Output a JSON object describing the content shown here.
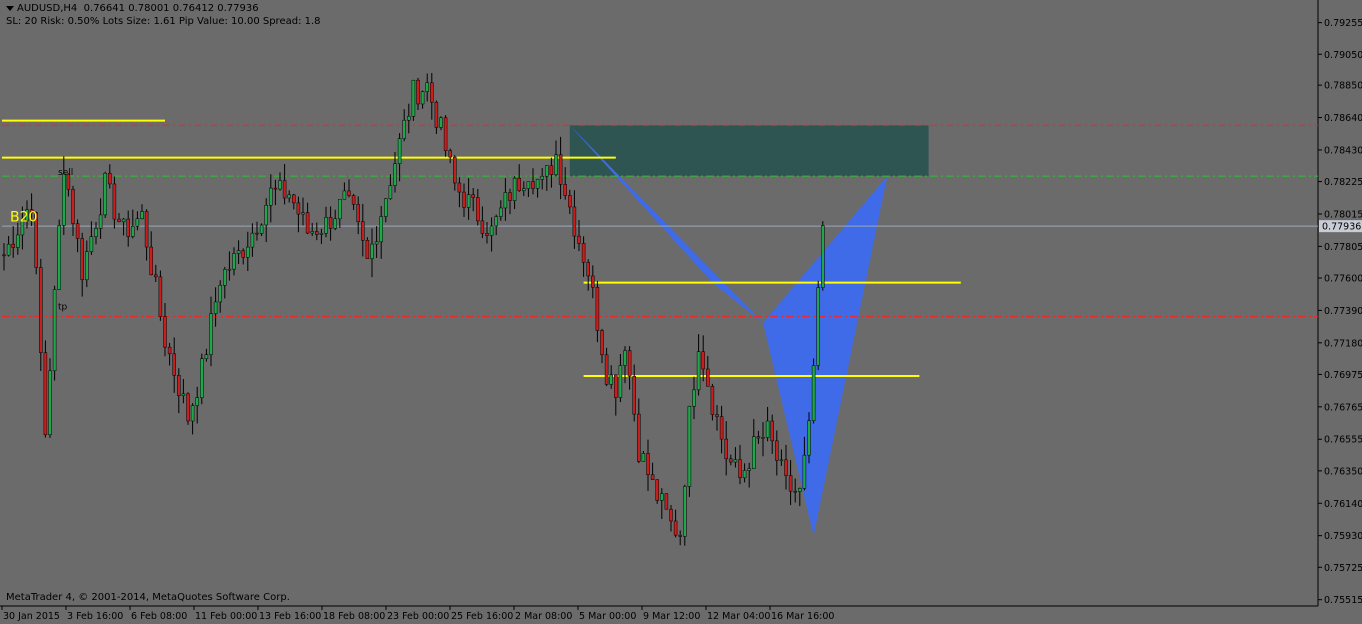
{
  "header": {
    "symbol": "AUDUSD,H4",
    "ohlc": "0.76641 0.78001 0.76412 0.77936",
    "risk_line": "SL: 20 Risk: 0.50%  Lots Size: 1.61 Pip Value: 10.00 Spread: 1.8"
  },
  "footer": {
    "copyright": "MetaTrader 4, © 2001-2014, MetaQuotes Software Corp."
  },
  "colors": {
    "background": "#6b6b6b",
    "bull": "#1fa84a",
    "bear": "#c81e1e",
    "wick": "#000000",
    "pattern": "#3d6cf0",
    "zone": "#2f5552",
    "level_yellow": "#ffff00",
    "level_red": "#ff2020",
    "level_green": "#30c030",
    "current_price_line": "#9aa7b8"
  },
  "chart_data": {
    "type": "candlestick",
    "timeframe": "H4",
    "ylim": [
      0.755,
      0.7935
    ],
    "y_ticks": [
      "0.79255",
      "0.79050",
      "0.78850",
      "0.78640",
      "0.78430",
      "0.78225",
      "0.78015",
      "0.77805",
      "0.77600",
      "0.77390",
      "0.77180",
      "0.76975",
      "0.76765",
      "0.76555",
      "0.76350",
      "0.76140",
      "0.75930",
      "0.75725",
      "0.75515"
    ],
    "x_labels": [
      "30 Jan 2015",
      "3 Feb 16:00",
      "6 Feb 08:00",
      "11 Feb 00:00",
      "13 Feb 16:00",
      "18 Feb 08:00",
      "23 Feb 00:00",
      "25 Feb 16:00",
      "2 Mar 08:00",
      "5 Mar 00:00",
      "9 Mar 12:00",
      "12 Mar 04:00",
      "16 Mar 16:00"
    ],
    "current_price": 0.77936,
    "current_price_label": "0.77936",
    "anchors": [
      [
        0,
        0.7775
      ],
      [
        6,
        0.781
      ],
      [
        9,
        0.766
      ],
      [
        13,
        0.7835
      ],
      [
        17,
        0.7765
      ],
      [
        22,
        0.782
      ],
      [
        26,
        0.779
      ],
      [
        30,
        0.78
      ],
      [
        35,
        0.772
      ],
      [
        40,
        0.767
      ],
      [
        43,
        0.77
      ],
      [
        47,
        0.776
      ],
      [
        51,
        0.7775
      ],
      [
        54,
        0.779
      ],
      [
        58,
        0.7815
      ],
      [
        62,
        0.7815
      ],
      [
        66,
        0.779
      ],
      [
        70,
        0.7795
      ],
      [
        74,
        0.781
      ],
      [
        76,
        0.78
      ],
      [
        79,
        0.777
      ],
      [
        84,
        0.7825
      ],
      [
        89,
        0.788
      ],
      [
        92,
        0.7885
      ],
      [
        95,
        0.7855
      ],
      [
        98,
        0.782
      ],
      [
        102,
        0.7805
      ],
      [
        106,
        0.779
      ],
      [
        110,
        0.7815
      ],
      [
        114,
        0.783
      ],
      [
        117,
        0.782
      ],
      [
        120,
        0.784
      ],
      [
        124,
        0.7795
      ],
      [
        127,
        0.7765
      ],
      [
        131,
        0.77
      ],
      [
        133,
        0.769
      ],
      [
        135,
        0.772
      ],
      [
        138,
        0.765
      ],
      [
        141,
        0.7625
      ],
      [
        145,
        0.76
      ],
      [
        147,
        0.7595
      ],
      [
        149,
        0.767
      ],
      [
        151,
        0.772
      ],
      [
        154,
        0.768
      ],
      [
        157,
        0.7645
      ],
      [
        160,
        0.763
      ],
      [
        163,
        0.765
      ],
      [
        166,
        0.766
      ],
      [
        170,
        0.7625
      ],
      [
        173,
        0.762
      ],
      [
        175,
        0.766
      ],
      [
        177,
        0.7745
      ],
      [
        178,
        0.7794
      ]
    ],
    "pattern_XABCD": [
      0.7859,
      0.7757,
      0.7731,
      0.7593,
      0.7826
    ],
    "supply_zone": [
      0.7826,
      0.7859
    ],
    "levels": [
      {
        "type": "red-dashdot",
        "price": 0.7859
      },
      {
        "type": "green-dashdot",
        "price": 0.7826
      },
      {
        "type": "red-dashdot",
        "price": 0.7735
      },
      {
        "type": "yellow",
        "price": 0.7862
      },
      {
        "type": "yellow",
        "price": 0.7838
      },
      {
        "type": "yellow",
        "price": 0.7757
      },
      {
        "type": "yellow",
        "price": 0.76965
      }
    ],
    "overlay_label": "B20",
    "order_labels": [
      "sell",
      "tp"
    ]
  }
}
